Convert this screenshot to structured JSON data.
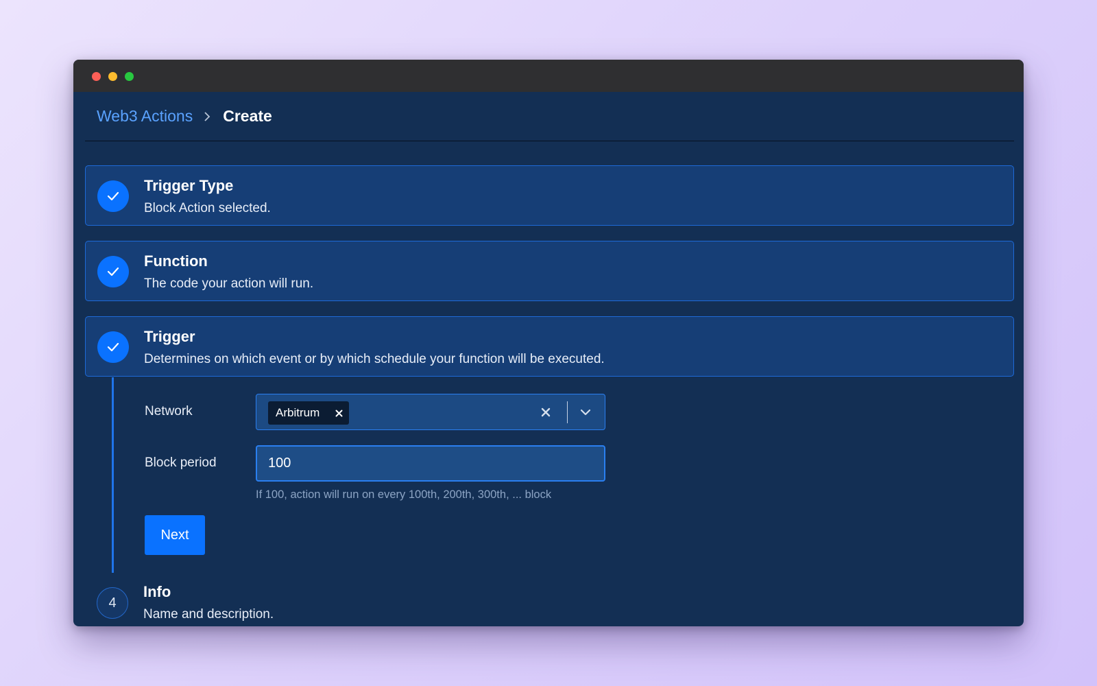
{
  "window_controls": [
    "close",
    "minimize",
    "maximize"
  ],
  "breadcrumb": {
    "parent": "Web3 Actions",
    "separator_icon": "chevron-right-icon",
    "current": "Create"
  },
  "steps": [
    {
      "title": "Trigger Type",
      "description": "Block Action selected.",
      "status": "completed",
      "icon": "check-icon"
    },
    {
      "title": "Function",
      "description": "The code your action will run.",
      "status": "completed",
      "icon": "check-icon"
    },
    {
      "title": "Trigger",
      "description": "Determines on which event or by which schedule your function will be executed.",
      "status": "active",
      "icon": "check-icon"
    },
    {
      "number": "4",
      "title": "Info",
      "description": "Name and description.",
      "status": "pending"
    }
  ],
  "trigger_form": {
    "network": {
      "label": "Network",
      "selected_tags": [
        "Arbitrum"
      ],
      "clear_icon": "x-icon",
      "dropdown_icon": "chevron-down-icon"
    },
    "block_period": {
      "label": "Block period",
      "value": "100",
      "hint": "If 100, action will run on every 100th, 200th, 300th, ... block"
    },
    "next_button": "Next"
  },
  "colors": {
    "accent": "#0A72FF",
    "link": "#5AA2FF",
    "panel_background": "#132F54",
    "card_background": "#163E76",
    "titlebar": "#2F2F31"
  }
}
